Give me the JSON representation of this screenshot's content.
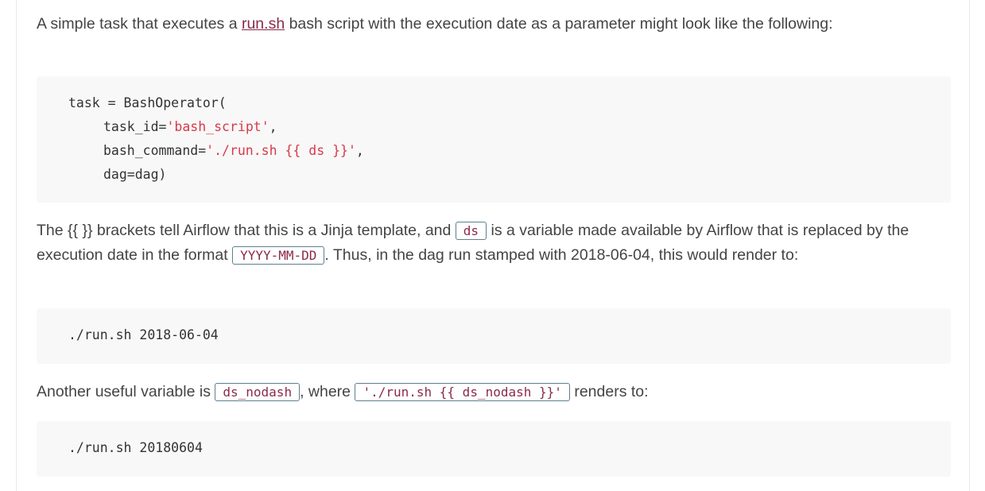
{
  "intro": {
    "before": "A simple task that executes a ",
    "link": "run.sh",
    "after": " bash script with the execution date as a parameter might look like the following:"
  },
  "code1": {
    "l1": "task = BashOperator(",
    "l2a": "task_id=",
    "l2b": "'bash_script'",
    "l2c": ",",
    "l3a": "bash_command=",
    "l3b": "'./run.sh {{ ds }}'",
    "l3c": ",",
    "l4": "dag=dag)"
  },
  "para2": {
    "t1": "The {{ }} brackets tell Airflow that this is a Jinja template, and ",
    "c1": "ds",
    "t2": " is a variable made available by Airflow that is replaced by the execution date in the format ",
    "c2": "YYYY-MM-DD",
    "t3": ". Thus, in the dag run stamped with 2018-06-04, this would render to:"
  },
  "code2": "./run.sh 2018-06-04",
  "para3": {
    "t1": "Another useful variable is ",
    "c1": "ds_nodash",
    "t2": ", where ",
    "c2": "'./run.sh {{ ds_nodash }}'",
    "t3": " renders to:"
  },
  "code3": "./run.sh 20180604",
  "colors": {
    "link": "#8b2a4a",
    "string": "#d73a49",
    "code_bg": "#f8f8f8",
    "inline_border": "#5f7f8f"
  }
}
